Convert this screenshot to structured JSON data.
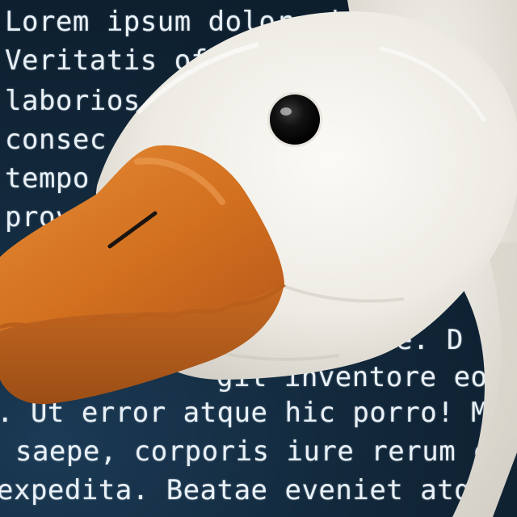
{
  "screen_text": {
    "lines": [
      "Lorem ipsum dolor si",
      "Veritatis of",
      "laborios",
      "consec",
      "tempo",
      "provi",
      "ure. D",
      "git inventore eo",
      ". Ut error atque hic porro! Ma",
      " saepe, corporis iure rerum c",
      "expedita. Beatae eveniet atq"
    ]
  },
  "colors": {
    "screen_background": "#112638",
    "screen_text": "#e9f1f7",
    "plush_fur": "#f3f1ec",
    "beak": "#d9782a",
    "eye": "#121212"
  }
}
